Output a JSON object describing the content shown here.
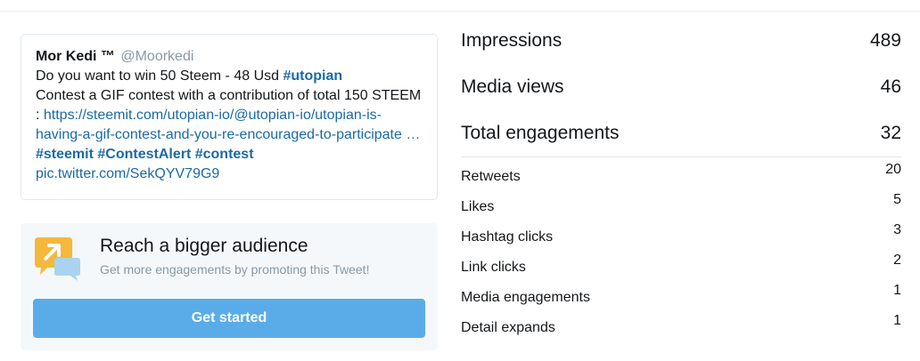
{
  "tweet": {
    "author_name": "Mor Kedi ™",
    "author_handle": "@Moorkedi",
    "text_1": "Do you want to win 50 Steem - 48 Usd ",
    "hashtag_utopian": "#utopian",
    "text_2": "Contest a GIF contest with a contribution of total 150 STEEM : ",
    "link_1": "https://steemit.com/utopian-io/@utopian-io/utopian-is-having-a-gif-contest-and-you-re-encouraged-to-participate …",
    "hashtag_steemit": "#steemit",
    "hashtag_contestalert": "#ContestAlert",
    "hashtag_contest": "#contest",
    "pic_link": "pic.twitter.com/SekQYV79G9"
  },
  "promo": {
    "title": "Reach a bigger audience",
    "subtitle": "Get more engagements by promoting this Tweet!",
    "button_label": "Get started",
    "icon": "promote-megaphone-icon",
    "icon_color": "#f5b83d",
    "button_color": "#5aace8"
  },
  "metrics": {
    "impressions": {
      "label": "Impressions",
      "value": "489"
    },
    "media_views": {
      "label": "Media views",
      "value": "46"
    },
    "total_engagements": {
      "label": "Total engagements",
      "value": "32"
    },
    "breakdown": [
      {
        "label": "Retweets",
        "value": "20"
      },
      {
        "label": "Likes",
        "value": "5"
      },
      {
        "label": "Hashtag clicks",
        "value": "3"
      },
      {
        "label": "Link clicks",
        "value": "2"
      },
      {
        "label": "Media engagements",
        "value": "1"
      },
      {
        "label": "Detail expands",
        "value": "1"
      }
    ]
  },
  "colors": {
    "link": "#1b6aa5",
    "muted": "#8899a6",
    "text": "#14171a"
  }
}
